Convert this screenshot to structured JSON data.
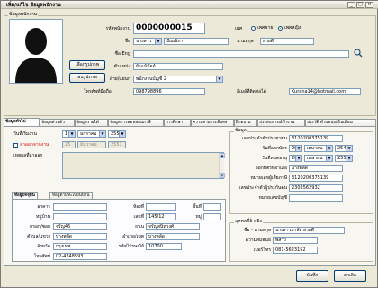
{
  "window": {
    "title": "เพิ่ม/แก้ไข ข้อมูลพนักงาน",
    "controls": [
      "_",
      "□",
      "×"
    ]
  },
  "header": {
    "group_title": "ข้อมูลพนักงาน",
    "choose_photo_label": "เลือกรูปภาพ",
    "clear_photo_label": "ลบรูปภาพ",
    "emp_code_label": "รหัสพนักงาน",
    "emp_code_value": "0000000015",
    "gender_label": "เพศ",
    "gender_options": [
      "เพศชาย",
      "เพศหญิง"
    ],
    "gender_selected": 1,
    "prefix_label": "ชื่อ",
    "prefix_value": "นางสาว",
    "first_name_value": "ปัณณิกา",
    "last_name_label": "นามสกุล",
    "last_name_value": "สวยดี",
    "english_name_label": "ชื่อ Eng",
    "english_name_value": "",
    "position_label": "ตำแหน่ง",
    "position_value": "ผ้าแม้มัจฉ์",
    "section_label": "ฝ่าย/แผนก",
    "section_value": "พนักงานบัญชี 2",
    "phone_label": "โทรศัพท์มือถือ",
    "phone_value": "098798896",
    "email_label": "อีเมล์ที่ติดต่อได้",
    "email_value": "Kurana14@hotmail.com",
    "search_icon": "search-icon"
  },
  "tabs": [
    {
      "label": "ข้อมูลทั่วไป",
      "active": true
    },
    {
      "label": "ข้อมูลส่วนตัว"
    },
    {
      "label": "ข้อมูลรายได้"
    },
    {
      "label": "ข้อมูลการลดหย่อนภาษี"
    },
    {
      "label": "การศึกษา"
    },
    {
      "label": "ความสามารถพิเศษ"
    },
    {
      "label": "ฝึกอบรม"
    },
    {
      "label": "ประสบการณ์ทำงาน"
    },
    {
      "label": "ประวัติ ตำแหน่ง/เงินเดือน"
    }
  ],
  "general": {
    "start_date_label": "วันที่เริ่มงาน",
    "start_day": "1",
    "start_month": "มกราคม",
    "start_year": "2550",
    "resign_label": "ลาออกจากงาน",
    "resign_day": "25",
    "resign_month": "ธันวาคม",
    "resign_year": "2551",
    "resign_reason_label": "เหตุผลที่ลาออก",
    "address_tabs": [
      "ที่อยู่ปัจจุบัน",
      "ที่อยู่ตามทะเบียนบ้าน"
    ],
    "address": {
      "house_no_label": "อาคาร",
      "house_no_value": "",
      "room_label": "ห้องที่",
      "room_value": "",
      "floor_label": "ชั้นที่",
      "floor_value": "",
      "village_label": "หมู่บ้าน",
      "village_value": "",
      "number_label": "เลขที่",
      "number_value": "145/12",
      "moo_label": "หมู่",
      "moo_value": "",
      "soi_label": "ตรอก/ซอย",
      "soi_value": "จรัญ46",
      "road_label": "ถนน",
      "road_value": "จรัญสนิทวงศ์",
      "subdistrict_label": "ตำบล/แขวง",
      "subdistrict_value": "บางพลัด",
      "district_label": "อำเภอ/เขต",
      "district_value": "บางพลัด",
      "province_label": "จังหวัด",
      "province_value": "กรุงเทพ",
      "postcode_label": "รหัสไปรษณีย์",
      "postcode_value": "10700",
      "phone_label": "โทรศัพท์",
      "phone_value": "02-4248593"
    },
    "id_group": {
      "title": "ข้อมูล",
      "id_card_label": "เลขประจำตัวประชาชน",
      "id_card_value": "3120200375139",
      "issue_date_label": "วันที่ออกบัตร",
      "issue_day": "20",
      "issue_month": "เมษายน",
      "issue_year": "2545",
      "expire_date_label": "วันที่หมดอายุ",
      "expire_day": "20",
      "expire_month": "เมษายน",
      "expire_year": "2550",
      "issued_at_label": "ออกบัตรที่อำเภอ",
      "issued_at_value": "บางพลัด",
      "tax_id_label": "หมายเลขผู้เสียภาษี",
      "tax_id_value": "3120200375139",
      "social_sec_label": "เลขประจำตัวผู้ประกันตน",
      "social_sec_value": "2302562932",
      "bank_label": "หมายเลขบัญชี",
      "bank_value": ""
    },
    "reference": {
      "title": "บุคคลที่อ้างอิง",
      "name_label": "ชื่อ - นามสกุล",
      "name_value": "นางสาวมาลัย สวยดี",
      "relation_label": "ความสัมพันธ์",
      "relation_value": "พี่สาว",
      "phone_label": "เบอร์โทร",
      "phone_value": "081-5623152"
    }
  },
  "footer": {
    "save_label": "บันทึก",
    "cancel_label": "ยกเลิก"
  },
  "colors": {
    "window_bg": "#ece9d8",
    "input_border": "#7f9db9",
    "accent": "#003c74"
  }
}
